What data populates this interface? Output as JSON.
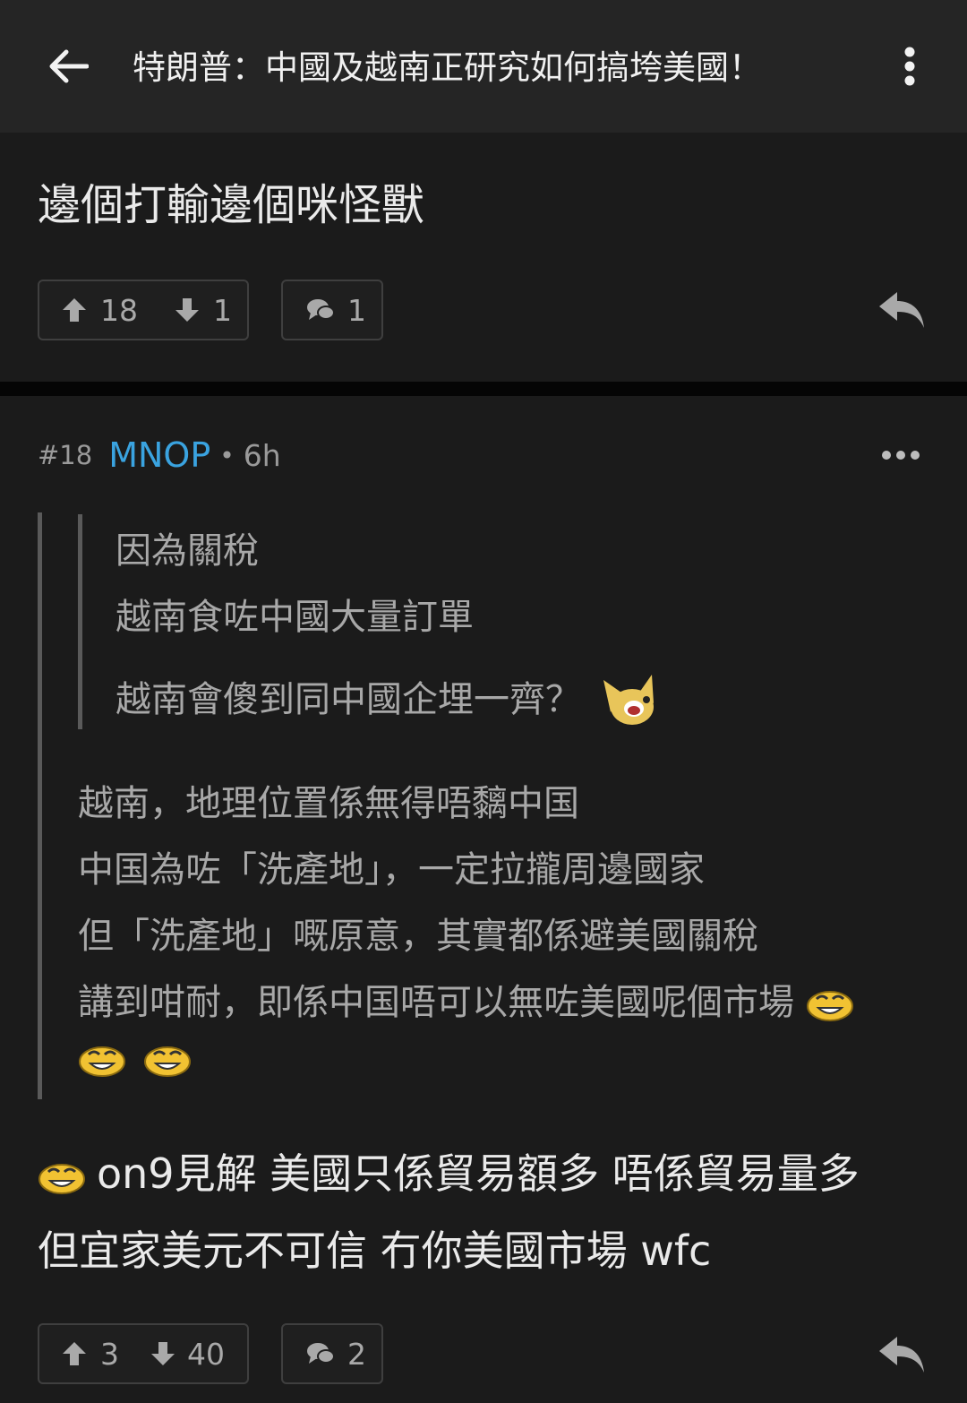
{
  "header": {
    "title": "特朗普：中國及越南正研究如何搞垮美國！",
    "back_icon": "arrow-left-icon",
    "menu_icon": "more-vert-icon"
  },
  "prev_post": {
    "text": "邊個打輸邊個咪怪獸",
    "upvotes": "18",
    "downvotes": "1",
    "comments": "1"
  },
  "post": {
    "number": "#18",
    "username": "MNOP",
    "separator": "•",
    "time": "6h",
    "inner_quote": [
      "因為關稅",
      "越南食咗中國大量訂單",
      "越南會傻到同中國企埋一齊？"
    ],
    "outer_quote": [
      "越南，地理位置係無得唔黐中国",
      "中国為咗「洗產地」，一定拉攏周邊國家",
      "但「洗產地」嘅原意，其實都係避美國關稅",
      "講到咁耐，即係中国唔可以無咗美國呢個市場"
    ],
    "reply_lines": [
      "on9見解 美國只係貿易額多 唔係貿易量多",
      "但宜家美元不可信 冇你美國市場 wfc"
    ],
    "upvotes": "3",
    "downvotes": "40",
    "comments": "2"
  },
  "colors": {
    "username": "#3aa3e0",
    "header_bg": "#252525",
    "card_bg": "#1b1b1b"
  }
}
